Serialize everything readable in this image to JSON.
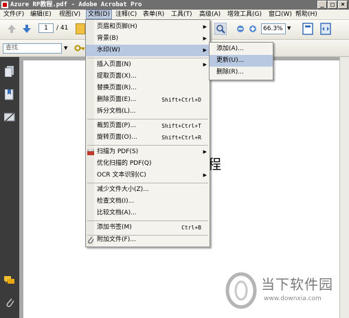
{
  "window": {
    "title": "Azure RP教程.pdf - Adobe Acrobat Pro"
  },
  "menubar": {
    "items": [
      {
        "label": "文件(F)"
      },
      {
        "label": "编辑(E)"
      },
      {
        "label": "视图(V)"
      },
      {
        "label": "文档(D)"
      },
      {
        "label": "注释(C)"
      },
      {
        "label": "表单(R)"
      },
      {
        "label": "工具(T)"
      },
      {
        "label": "高级(A)"
      },
      {
        "label": "增效工具(G)"
      },
      {
        "label": "窗口(W)"
      },
      {
        "label": "帮助(H)"
      }
    ]
  },
  "toolbar": {
    "page_current": "1",
    "page_total": "/ 41",
    "zoom": "66.3%"
  },
  "search": {
    "placeholder": "查找"
  },
  "document_menu": {
    "items": [
      {
        "label": "页眉和页脚(H)",
        "shortcut": "",
        "submenu": true
      },
      {
        "label": "背景(B)",
        "shortcut": "",
        "submenu": true
      },
      {
        "label": "水印(W)",
        "shortcut": "",
        "submenu": true
      },
      {
        "label": "插入页面(N)",
        "shortcut": "",
        "submenu": true
      },
      {
        "label": "提取页面(X)...",
        "shortcut": ""
      },
      {
        "label": "替换页面(R)...",
        "shortcut": ""
      },
      {
        "label": "删除页面(E)...",
        "shortcut": "Shift+Ctrl+D"
      },
      {
        "label": "拆分文档(L)...",
        "shortcut": ""
      },
      {
        "label": "裁剪页面(P)...",
        "shortcut": "Shift+Ctrl+T"
      },
      {
        "label": "旋转页面(O)...",
        "shortcut": "Shift+Ctrl+R"
      },
      {
        "label": "扫描为 PDF(S)",
        "shortcut": "",
        "submenu": true
      },
      {
        "label": "优化扫描的 PDF(Q)",
        "shortcut": ""
      },
      {
        "label": "OCR 文本识别(C)",
        "shortcut": "",
        "submenu": true
      },
      {
        "label": "减少文件大小(Z)...",
        "shortcut": ""
      },
      {
        "label": "检查文档(I)...",
        "shortcut": ""
      },
      {
        "label": "比较文档(A)...",
        "shortcut": ""
      },
      {
        "label": "添加书签(M)",
        "shortcut": "Ctrl+B"
      },
      {
        "label": "附加文件(F)...",
        "shortcut": ""
      }
    ]
  },
  "watermark_submenu": {
    "items": [
      {
        "label": "添加(A)..."
      },
      {
        "label": "更新(U)..."
      },
      {
        "label": "删除(R)..."
      }
    ]
  },
  "document": {
    "visible_text": "程"
  },
  "site_watermark": {
    "name": "当下软件园",
    "url": "www.downxia.com"
  }
}
